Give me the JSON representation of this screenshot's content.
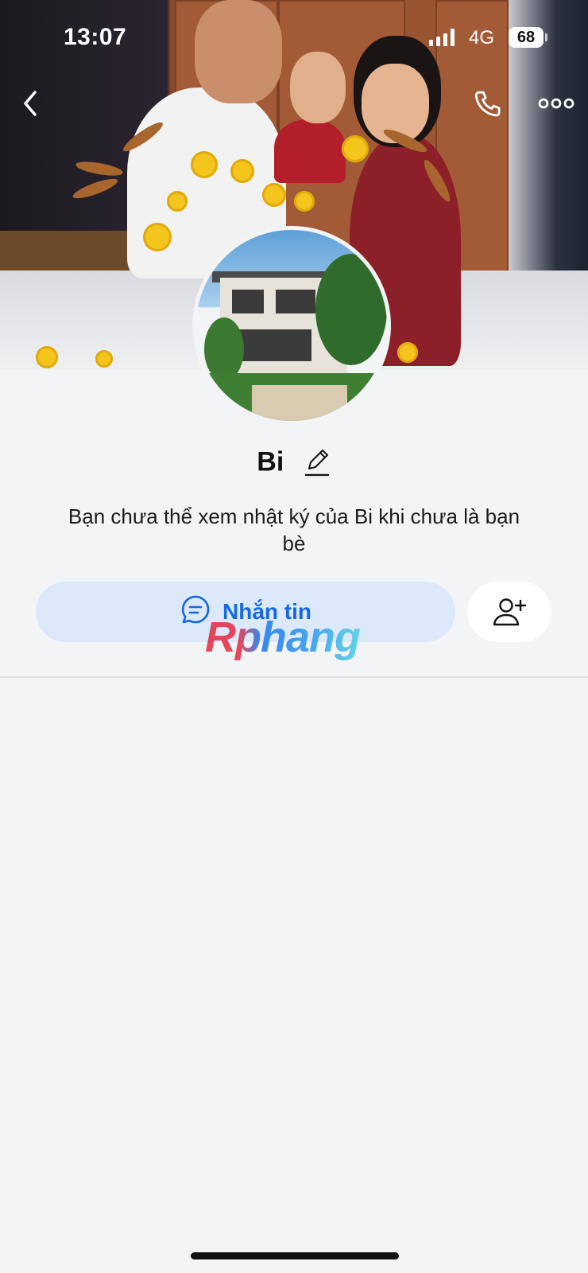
{
  "status_bar": {
    "time": "13:07",
    "network": "4G",
    "battery": "68"
  },
  "header": {
    "back_icon": "chevron-left-icon",
    "call_icon": "phone-icon",
    "more_icon": "more-horizontal-icon"
  },
  "profile": {
    "name": "Bi",
    "edit_icon": "pencil-icon",
    "notice": "Bạn chưa thể xem nhật ký của Bi khi chưa là bạn bè"
  },
  "actions": {
    "message_label": "Nhắn tin",
    "message_icon": "chat-bubble-icon",
    "add_friend_icon": "add-friend-icon"
  },
  "watermark": {
    "text": "Rphang"
  },
  "colors": {
    "accent": "#1567e2",
    "message_button_bg": "#dce9fb",
    "page_bg": "#f3f4f6"
  }
}
